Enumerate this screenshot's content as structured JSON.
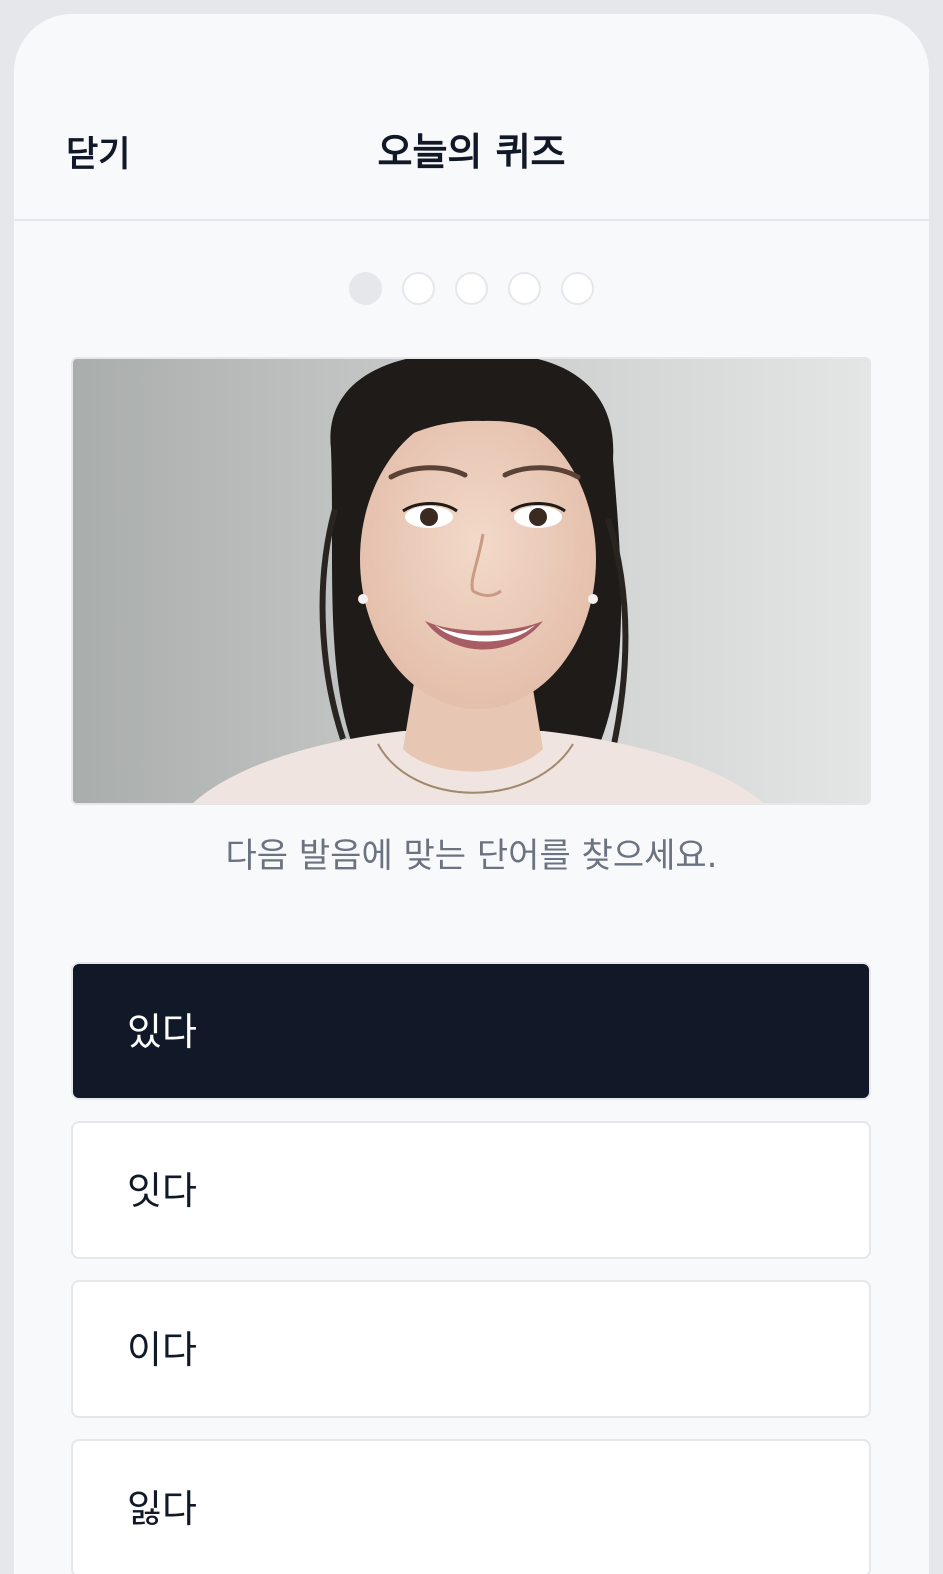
{
  "header": {
    "close_label": "닫기",
    "title": "오늘의 퀴즈"
  },
  "progress": {
    "total_steps": 5,
    "current_step": 1
  },
  "video": {
    "icon": "presenter-video"
  },
  "prompt": "다음 발음에 맞는 단어를 찾으세요.",
  "options": [
    {
      "label": "있다",
      "selected": true
    },
    {
      "label": "잇다",
      "selected": false
    },
    {
      "label": "이다",
      "selected": false
    },
    {
      "label": "잃다",
      "selected": false
    }
  ],
  "colors": {
    "selected_bg": "#111827",
    "page_bg": "#f8f9fb",
    "muted_text": "#6b7280"
  }
}
